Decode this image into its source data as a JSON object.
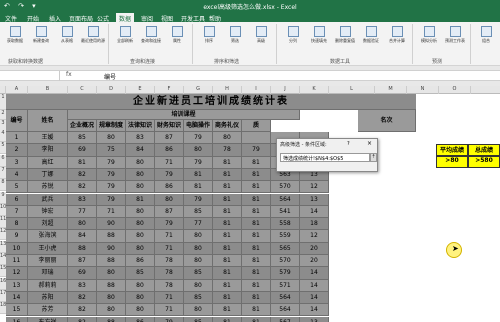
{
  "window": {
    "title": "excel高级筛选怎么做.xlsx - Excel",
    "quick_access": "↶ ↷ ▾"
  },
  "tabs": [
    "文件",
    "开始",
    "插入",
    "页面布局",
    "公式",
    "数据",
    "审阅",
    "视图",
    "开发工具",
    "帮助"
  ],
  "active_tab": "数据",
  "ribbon": {
    "groups": [
      {
        "label": "获取和转换数据",
        "buttons": [
          "获取数据",
          "新建查询",
          "从表格",
          "最近使用的源"
        ]
      },
      {
        "label": "查询和连接",
        "buttons": [
          "全部刷新",
          "查询和连接",
          "属性",
          "编辑链接"
        ]
      },
      {
        "label": "排序和筛选",
        "buttons": [
          "排序",
          "筛选",
          "清除",
          "重新应用",
          "高级"
        ]
      },
      {
        "label": "数据工具",
        "buttons": [
          "分列",
          "快速填充",
          "删除重复值",
          "数据验证",
          "合并计算",
          "关系"
        ]
      },
      {
        "label": "预测",
        "buttons": [
          "模拟分析",
          "预测工作表"
        ]
      },
      {
        "label": "分级显示",
        "buttons": [
          "组合",
          "取消组合",
          "分类汇总"
        ]
      }
    ]
  },
  "formula_bar": {
    "name_box": "",
    "fx": "fx",
    "content": "编号"
  },
  "sheet": {
    "col_letters": [
      "A",
      "B",
      "C",
      "D",
      "E",
      "F",
      "G",
      "H",
      "I",
      "J",
      "K",
      "L",
      "M",
      "N",
      "O"
    ],
    "row_numbers": [
      "1",
      "2",
      "3",
      "4",
      "5",
      "6",
      "7",
      "8",
      "9",
      "10",
      "11",
      "12",
      "13",
      "14",
      "15",
      "16",
      "17",
      "18"
    ],
    "title": "企业新进员工培训成绩统计表",
    "header_top": {
      "id": "编号",
      "name": "姓名",
      "group": "培训课程",
      "rank": "名次"
    },
    "header_courses": [
      "企业概况",
      "规章制度",
      "法律知识",
      "财务知识",
      "电脑操作",
      "商务礼仪",
      "质"
    ],
    "rows": [
      {
        "id": "1",
        "name": "王媛",
        "scores": [
          "85",
          "80",
          "83",
          "87",
          "79",
          "80",
          "",
          "",
          ""
        ]
      },
      {
        "id": "2",
        "name": "李阳",
        "scores": [
          "69",
          "75",
          "84",
          "86",
          "80",
          "78",
          "79",
          "548",
          "18"
        ]
      },
      {
        "id": "3",
        "name": "高红",
        "scores": [
          "81",
          "79",
          "80",
          "71",
          "79",
          "81",
          "81",
          "572",
          "11"
        ]
      },
      {
        "id": "4",
        "name": "丁娜",
        "scores": [
          "82",
          "79",
          "80",
          "79",
          "81",
          "81",
          "81",
          "563",
          "13"
        ]
      },
      {
        "id": "5",
        "name": "苏锐",
        "scores": [
          "82",
          "79",
          "80",
          "86",
          "81",
          "81",
          "81",
          "570",
          "12"
        ]
      },
      {
        "id": "6",
        "name": "武兵",
        "scores": [
          "83",
          "79",
          "81",
          "80",
          "79",
          "81",
          "81",
          "564",
          "13"
        ]
      },
      {
        "id": "7",
        "name": "钟宏",
        "scores": [
          "77",
          "71",
          "80",
          "87",
          "85",
          "81",
          "81",
          "541",
          "14"
        ]
      },
      {
        "id": "8",
        "name": "刘超",
        "scores": [
          "80",
          "90",
          "80",
          "79",
          "77",
          "81",
          "81",
          "558",
          "18"
        ]
      },
      {
        "id": "9",
        "name": "张海滨",
        "scores": [
          "84",
          "88",
          "80",
          "71",
          "80",
          "81",
          "81",
          "559",
          "12"
        ]
      },
      {
        "id": "10",
        "name": "王小虎",
        "scores": [
          "88",
          "90",
          "80",
          "71",
          "80",
          "81",
          "81",
          "565",
          "20"
        ]
      },
      {
        "id": "11",
        "name": "李丽丽",
        "scores": [
          "87",
          "88",
          "86",
          "78",
          "80",
          "81",
          "81",
          "570",
          "20"
        ]
      },
      {
        "id": "12",
        "name": "邓瑞",
        "scores": [
          "69",
          "80",
          "85",
          "78",
          "85",
          "81",
          "81",
          "579",
          "14"
        ]
      },
      {
        "id": "13",
        "name": "郝莉莉",
        "scores": [
          "83",
          "88",
          "80",
          "78",
          "80",
          "81",
          "81",
          "571",
          "14"
        ]
      },
      {
        "id": "14",
        "name": "苏阳",
        "scores": [
          "82",
          "80",
          "80",
          "71",
          "85",
          "81",
          "81",
          "564",
          "14"
        ]
      },
      {
        "id": "15",
        "name": "苏芳",
        "scores": [
          "82",
          "80",
          "80",
          "71",
          "80",
          "81",
          "81",
          "564",
          "14"
        ]
      },
      {
        "id": "16",
        "name": "东方祥",
        "scores": [
          "82",
          "88",
          "86",
          "79",
          "85",
          "81",
          "81",
          "567",
          "13"
        ]
      }
    ],
    "criteria": {
      "h1": "平均成绩",
      "h2": "总成绩",
      "v1": ">80",
      "v2": ">580"
    }
  },
  "dialog": {
    "title": "高级筛选 - 条件区域:",
    "help": "?",
    "close": "×",
    "value": "筛选成绩统计!$N$4:$O$5",
    "collapse": "⇡"
  }
}
